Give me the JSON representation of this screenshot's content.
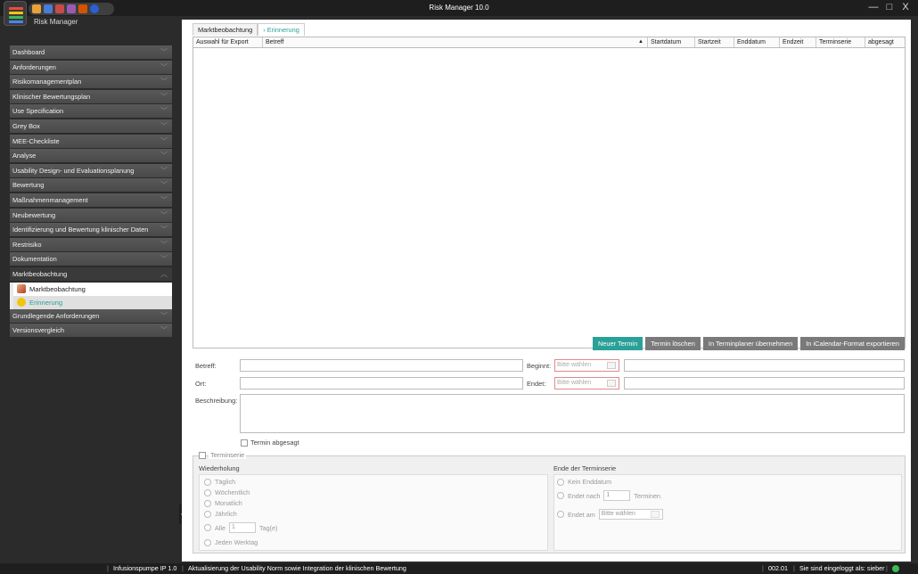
{
  "window": {
    "title": "Risk Manager  10.0",
    "app_name": "Risk Manager",
    "controls": {
      "minimize": "—",
      "maximize": "□",
      "close": "X"
    }
  },
  "sidebar": {
    "items": [
      {
        "label": "Dashboard"
      },
      {
        "label": "Anforderungen"
      },
      {
        "label": "Risikomanagementplan"
      },
      {
        "label": "Klinischer Bewertungsplan"
      },
      {
        "label": "Use Specification"
      },
      {
        "label": "Grey Box"
      },
      {
        "label": "MEE-Checkliste"
      },
      {
        "label": "Analyse"
      },
      {
        "label": "Usability Design- und Evaluationsplanung"
      },
      {
        "label": "Bewertung"
      },
      {
        "label": "Maßnahmenmanagement"
      },
      {
        "label": "Neubewertung"
      },
      {
        "label": "Identifizierung und Bewertung klinischer Daten"
      },
      {
        "label": "Restrisiko"
      },
      {
        "label": "Dokumentation"
      },
      {
        "label": "Marktbeobachtung"
      }
    ],
    "sub_items": [
      {
        "label": "Marktbeobachtung",
        "icon": "market-icon"
      },
      {
        "label": "Erinnerung",
        "icon": "reminder-icon"
      }
    ],
    "items_after": [
      {
        "label": "Grundlegende Anforderungen"
      },
      {
        "label": "Versionsvergleich"
      }
    ]
  },
  "tabs": [
    {
      "label": "Marktbeobachtung"
    },
    {
      "label": "Erinnerung"
    }
  ],
  "grid": {
    "columns": [
      "Auswahl für Export",
      "Betreff",
      "Startdatum",
      "Startzeit",
      "Enddatum",
      "Endzeit",
      "Terminserie",
      "abgesagt"
    ],
    "rows": []
  },
  "buttons": {
    "new": "Neuer Termin",
    "delete": "Termin löschen",
    "planner": "In Terminplaner übernehmen",
    "ical": "In iCalendar-Format exportieren"
  },
  "form": {
    "betreff_label": "Betreff:",
    "ort_label": "Ort:",
    "beschreibung_label": "Beschreibung:",
    "beginnt_label": "Beginnt:",
    "endet_label": "Endet:",
    "date_placeholder": "Bitte wählen",
    "cancelled_label": "Termin abgesagt"
  },
  "series": {
    "label": "Terminserie",
    "repeat_title": "Wiederholung",
    "repeat_options": [
      "Täglich",
      "Wöchentlich",
      "Monatlich",
      "Jährlich"
    ],
    "every_label": "Alle",
    "every_value": "1",
    "every_unit": "Tag(e)",
    "workday": "Jeden Werktag",
    "end_title": "Ende der Terminserie",
    "no_end": "Kein Enddatum",
    "ends_after": "Endet nach",
    "ends_after_value": "1",
    "ends_after_unit": "Terminen.",
    "ends_on": "Endet am",
    "ends_on_placeholder": "Bitte wählen"
  },
  "status": {
    "project": "Infusionspumpe IP 1.0",
    "message": "Aktualisierung der Usability Norm sowie Integration der klinischen Bewertung",
    "code": "002.01",
    "login": "Sie sind eingeloggt als: sieber"
  },
  "colors": {
    "accent": "#2aa198",
    "error_border": "#e0898e",
    "sidebar_bg": "#4f4f4f"
  }
}
